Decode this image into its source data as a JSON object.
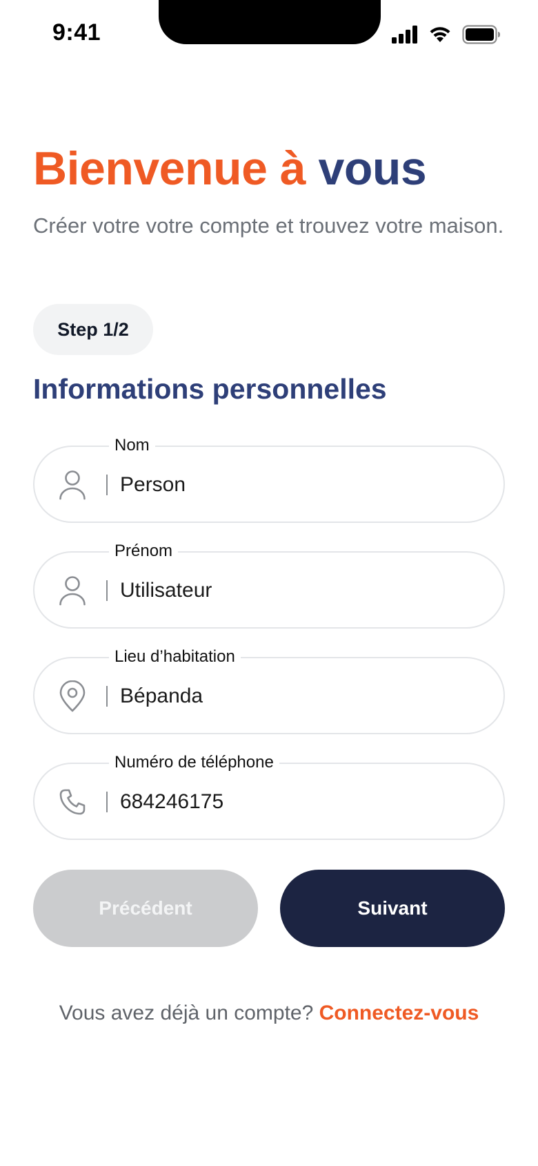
{
  "status_bar": {
    "time": "9:41",
    "icons": [
      "signal-icon",
      "wifi-icon",
      "battery-icon"
    ]
  },
  "header": {
    "title_part1": "Bienvenue à ",
    "title_part2": "vous",
    "subtitle": "Créer votre votre compte et trouvez votre maison."
  },
  "step": {
    "label": "Step 1/2"
  },
  "section": {
    "title": "Informations personnelles"
  },
  "form": {
    "fields": [
      {
        "label": "Nom",
        "value": "Person",
        "icon": "user-icon"
      },
      {
        "label": "Prénom",
        "value": "Utilisateur",
        "icon": "user-icon"
      },
      {
        "label": "Lieu d’habitation",
        "value": "Bépanda",
        "icon": "location-pin-icon"
      },
      {
        "label": "Numéro de téléphone",
        "value": "684246175",
        "icon": "phone-icon"
      }
    ]
  },
  "buttons": {
    "previous": "Précédent",
    "next": "Suivant"
  },
  "footer": {
    "text": "Vous avez déjà un compte? ",
    "link": "Connectez-vous"
  },
  "colors": {
    "accent_orange": "#EF5A24",
    "accent_navy": "#2E3F78",
    "button_dark": "#1C2442",
    "button_disabled": "#CBCCCE"
  }
}
